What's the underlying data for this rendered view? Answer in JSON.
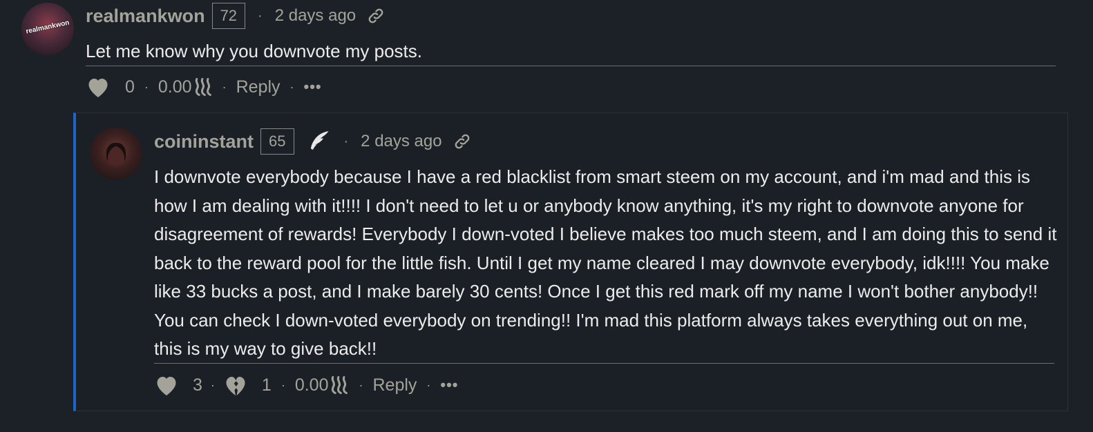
{
  "comments": [
    {
      "author": "realmankwon",
      "reputation": "72",
      "avatar_text": "realmankwon",
      "time": "2 days ago",
      "body": "Let me know why you downvote my posts.",
      "upvotes": "0",
      "payout": "0.00",
      "reply_label": "Reply",
      "more_label": "•••"
    },
    {
      "author": "coininstant",
      "reputation": "65",
      "time": "2 days ago",
      "body": "I downvote everybody because I have a red blacklist from smart steem on my account, and i'm mad and this is how I am dealing with it!!!! I don't need to let u or anybody know anything, it's my right to downvote anyone for disagreement of rewards! Everybody I down-voted I believe makes too much steem, and I am doing this to send it back to the reward pool for the little fish. Until I get my name cleared I may downvote everybody, idk!!!! You make like 33 bucks a post, and I make barely 30 cents! Once I get this red mark off my name I won't bother anybody!! You can check I down-voted everybody on trending!! I'm mad this platform always takes everything out on me, this is my way to give back!!",
      "upvotes": "3",
      "downvotes": "1",
      "payout": "0.00",
      "reply_label": "Reply",
      "more_label": "•••"
    }
  ],
  "separator": "·",
  "colors": {
    "background": "#1c2127",
    "accent_border": "#1f64c8",
    "muted": "#a3a39a"
  },
  "icons": [
    "heart-icon",
    "broken-heart-icon",
    "steem-icon",
    "link-icon",
    "feather-icon"
  ]
}
